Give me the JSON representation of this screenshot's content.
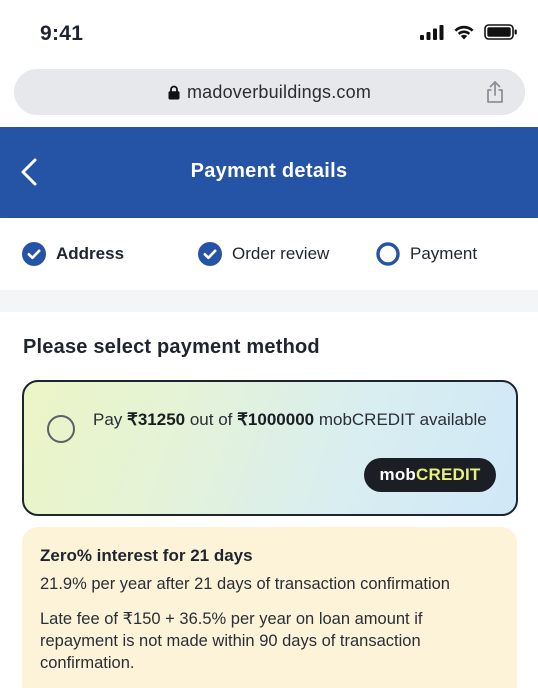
{
  "status_bar": {
    "time": "9:41"
  },
  "browser": {
    "url": "madoverbuildings.com"
  },
  "header": {
    "title": "Payment details"
  },
  "steps": [
    {
      "label": "Address",
      "state": "complete"
    },
    {
      "label": "Order review",
      "state": "complete"
    },
    {
      "label": "Payment",
      "state": "current"
    }
  ],
  "section_title": "Please select payment method",
  "credit_option": {
    "prefix": "Pay ",
    "amount": "₹31250",
    "middle": " out of ",
    "limit": "₹1000000",
    "suffix": " mobCREDIT available",
    "badge_part1": "mob",
    "badge_part2": "CREDIT",
    "selected": false
  },
  "info": {
    "title": "Zero% interest for 21 days",
    "line1": "21.9% per year after 21 days of transaction confirmation",
    "line2": "Late fee of ₹150 + 36.5% per year on loan amount if repayment is not made within 90 days of transaction confirmation."
  },
  "colors": {
    "primary": "#2553a5",
    "info_bg": "#fcf3d8",
    "badge_bg": "#1b1e24",
    "badge_accent": "#e7f07a"
  }
}
